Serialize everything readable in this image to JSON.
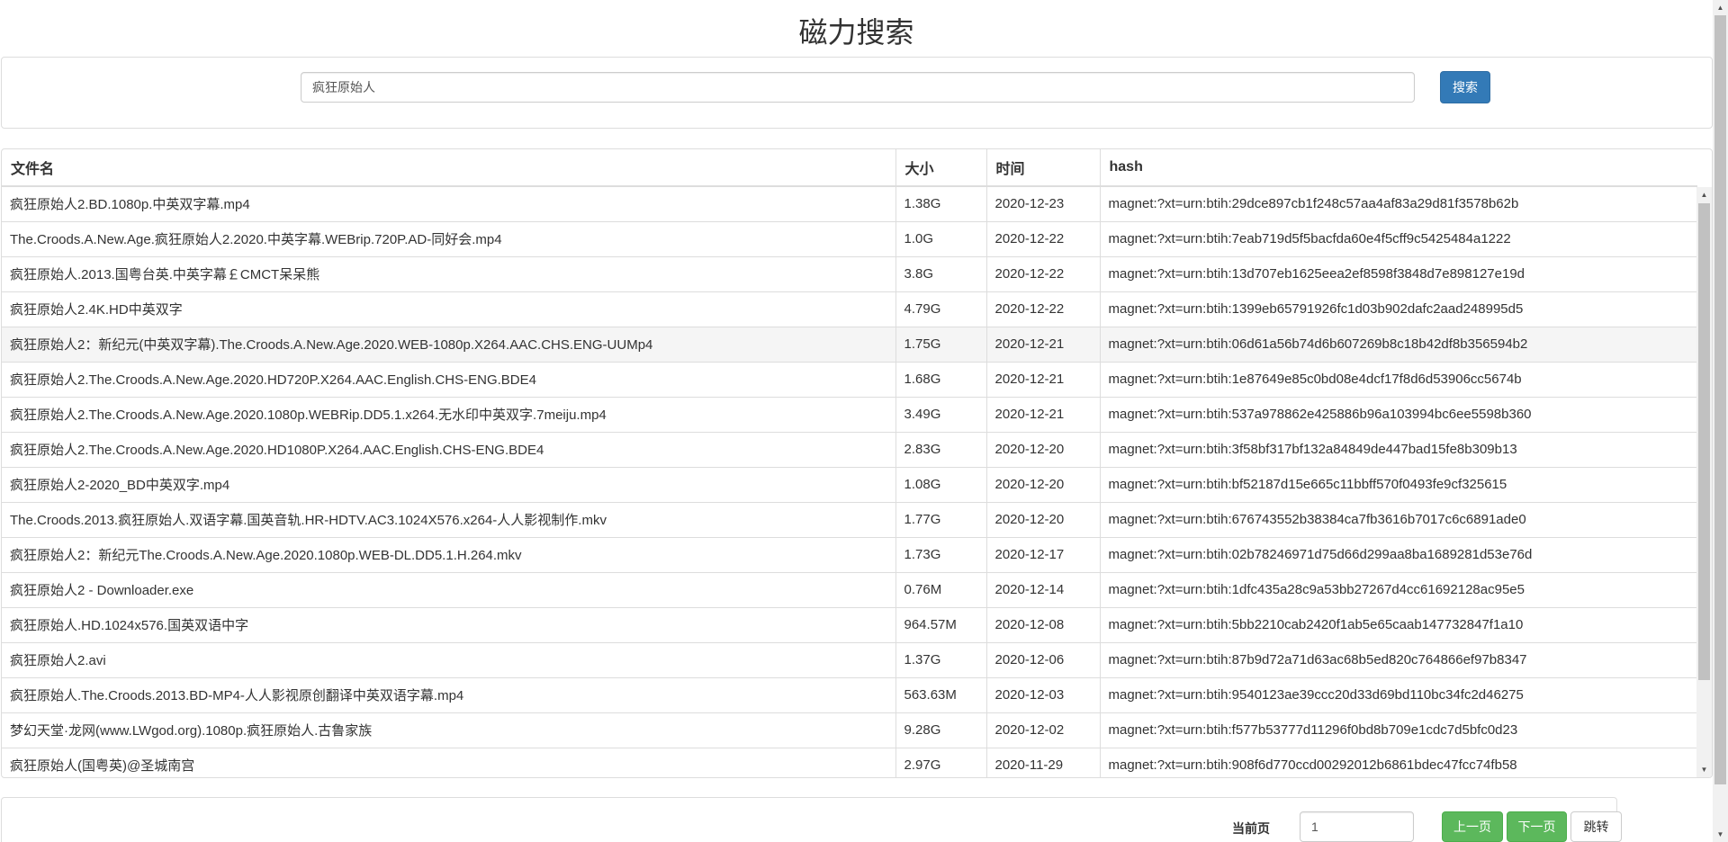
{
  "header": {
    "title": "磁力搜索"
  },
  "search": {
    "value": "疯狂原始人",
    "button_label": "搜索"
  },
  "table": {
    "columns": {
      "name": "文件名",
      "size": "大小",
      "time": "时间",
      "hash": "hash"
    },
    "rows": [
      {
        "name": "疯狂原始人2.BD.1080p.中英双字幕.mp4",
        "size": "1.38G",
        "time": "2020-12-23",
        "hash": "magnet:?xt=urn:btih:29dce897cb1f248c57aa4af83a29d81f3578b62b"
      },
      {
        "name": "The.Croods.A.New.Age.疯狂原始人2.2020.中英字幕.WEBrip.720P.AD-同好会.mp4",
        "size": "1.0G",
        "time": "2020-12-22",
        "hash": "magnet:?xt=urn:btih:7eab719d5f5bacfda60e4f5cff9c5425484a1222"
      },
      {
        "name": "疯狂原始人.2013.国粤台英.中英字幕￡CMCT呆呆熊",
        "size": "3.8G",
        "time": "2020-12-22",
        "hash": "magnet:?xt=urn:btih:13d707eb1625eea2ef8598f3848d7e898127e19d"
      },
      {
        "name": "疯狂原始人2.4K.HD中英双字",
        "size": "4.79G",
        "time": "2020-12-22",
        "hash": "magnet:?xt=urn:btih:1399eb65791926fc1d03b902dafc2aad248995d5"
      },
      {
        "name": "疯狂原始人2：新纪元(中英双字幕).The.Croods.A.New.Age.2020.WEB-1080p.X264.AAC.CHS.ENG-UUMp4",
        "size": "1.75G",
        "time": "2020-12-21",
        "hash": "magnet:?xt=urn:btih:06d61a56b74d6b607269b8c18b42df8b356594b2"
      },
      {
        "name": "疯狂原始人2.The.Croods.A.New.Age.2020.HD720P.X264.AAC.English.CHS-ENG.BDE4",
        "size": "1.68G",
        "time": "2020-12-21",
        "hash": "magnet:?xt=urn:btih:1e87649e85c0bd08e4dcf17f8d6d53906cc5674b"
      },
      {
        "name": "疯狂原始人2.The.Croods.A.New.Age.2020.1080p.WEBRip.DD5.1.x264.无水印中英双字.7meiju.mp4",
        "size": "3.49G",
        "time": "2020-12-21",
        "hash": "magnet:?xt=urn:btih:537a978862e425886b96a103994bc6ee5598b360"
      },
      {
        "name": "疯狂原始人2.The.Croods.A.New.Age.2020.HD1080P.X264.AAC.English.CHS-ENG.BDE4",
        "size": "2.83G",
        "time": "2020-12-20",
        "hash": "magnet:?xt=urn:btih:3f58bf317bf132a84849de447bad15fe8b309b13"
      },
      {
        "name": "疯狂原始人2-2020_BD中英双字.mp4",
        "size": "1.08G",
        "time": "2020-12-20",
        "hash": "magnet:?xt=urn:btih:bf52187d15e665c11bbff570f0493fe9cf325615"
      },
      {
        "name": "The.Croods.2013.疯狂原始人.双语字幕.国英音轨.HR-HDTV.AC3.1024X576.x264-人人影视制作.mkv",
        "size": "1.77G",
        "time": "2020-12-20",
        "hash": "magnet:?xt=urn:btih:676743552b38384ca7fb3616b7017c6c6891ade0"
      },
      {
        "name": "疯狂原始人2：新纪元The.Croods.A.New.Age.2020.1080p.WEB-DL.DD5.1.H.264.mkv",
        "size": "1.73G",
        "time": "2020-12-17",
        "hash": "magnet:?xt=urn:btih:02b78246971d75d66d299aa8ba1689281d53e76d"
      },
      {
        "name": "疯狂原始人2 - Downloader.exe",
        "size": "0.76M",
        "time": "2020-12-14",
        "hash": "magnet:?xt=urn:btih:1dfc435a28c9a53bb27267d4cc61692128ac95e5"
      },
      {
        "name": "疯狂原始人.HD.1024x576.国英双语中字",
        "size": "964.57M",
        "time": "2020-12-08",
        "hash": "magnet:?xt=urn:btih:5bb2210cab2420f1ab5e65caab147732847f1a10"
      },
      {
        "name": "疯狂原始人2.avi",
        "size": "1.37G",
        "time": "2020-12-06",
        "hash": "magnet:?xt=urn:btih:87b9d72a71d63ac68b5ed820c764866ef97b8347"
      },
      {
        "name": "疯狂原始人.The.Croods.2013.BD-MP4-人人影视原创翻译中英双语字幕.mp4",
        "size": "563.63M",
        "time": "2020-12-03",
        "hash": "magnet:?xt=urn:btih:9540123ae39ccc20d33d69bd110bc34fc2d46275"
      },
      {
        "name": "梦幻天堂·龙网(www.LWgod.org).1080p.疯狂原始人.古鲁家族",
        "size": "9.28G",
        "time": "2020-12-02",
        "hash": "magnet:?xt=urn:btih:f577b53777d11296f0bd8b709e1cdc7d5bfc0d23"
      },
      {
        "name": "疯狂原始人(国粤英)@圣城南宫",
        "size": "2.97G",
        "time": "2020-11-29",
        "hash": "magnet:?xt=urn:btih:908f6d770ccd00292012b6861bdec47fcc74fb58"
      }
    ]
  },
  "pager": {
    "current_label": "当前页",
    "current_value": "1",
    "prev_label": "上一页",
    "next_label": "下一页",
    "jump_label": "跳转"
  },
  "colors": {
    "primary": "#337ab7",
    "success": "#5cb85c",
    "border": "#dddddd",
    "row_hover": "#f5f5f5"
  },
  "icons": {
    "scroll_up": "▲",
    "scroll_down": "▼"
  }
}
